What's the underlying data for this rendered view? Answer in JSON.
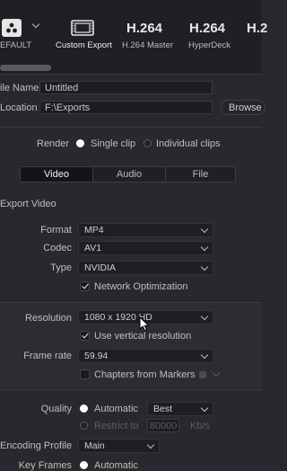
{
  "presets": [
    {
      "label": "EFAULT",
      "icon": "default-preset-icon"
    },
    {
      "label": "Custom Export",
      "icon": "film-strip-icon",
      "active": true
    },
    {
      "label": "H.264 Master",
      "big": "H.264"
    },
    {
      "label": "HyperDeck",
      "big": "H.264"
    },
    {
      "label": "H.2",
      "big": "H.2"
    }
  ],
  "file": {
    "name_label": "ile Name",
    "name_value": "Untitled",
    "location_label": "Location",
    "location_value": "F:\\Exports",
    "browse_label": "Browse"
  },
  "render": {
    "label": "Render",
    "single_clip": "Single clip",
    "individual_clips": "Individual clips",
    "selected": "single_clip"
  },
  "tabs": [
    {
      "label": "Video",
      "active": true
    },
    {
      "label": "Audio"
    },
    {
      "label": "File"
    }
  ],
  "video": {
    "section_title": "Export Video",
    "format_label": "Format",
    "format_value": "MP4",
    "codec_label": "Codec",
    "codec_value": "AV1",
    "type_label": "Type",
    "type_value": "NVIDIA",
    "network_optimization": "Network Optimization",
    "network_optimization_checked": true,
    "resolution_label": "Resolution",
    "resolution_value": "1080 x 1920 HD",
    "vertical_resolution": "Use vertical resolution",
    "vertical_resolution_checked": true,
    "frame_rate_label": "Frame rate",
    "frame_rate_value": "59.94",
    "chapters_label": "Chapters from Markers",
    "chapters_checked": false,
    "quality_label": "Quality",
    "quality_automatic": "Automatic",
    "quality_best": "Best",
    "restrict_label": "Restrict to",
    "restrict_value": "80000",
    "restrict_unit": "Kb/s",
    "encoding_profile_label": "Encoding Profile",
    "encoding_profile_value": "Main",
    "key_frames_label": "Key Frames",
    "key_frames_automatic": "Automatic"
  }
}
